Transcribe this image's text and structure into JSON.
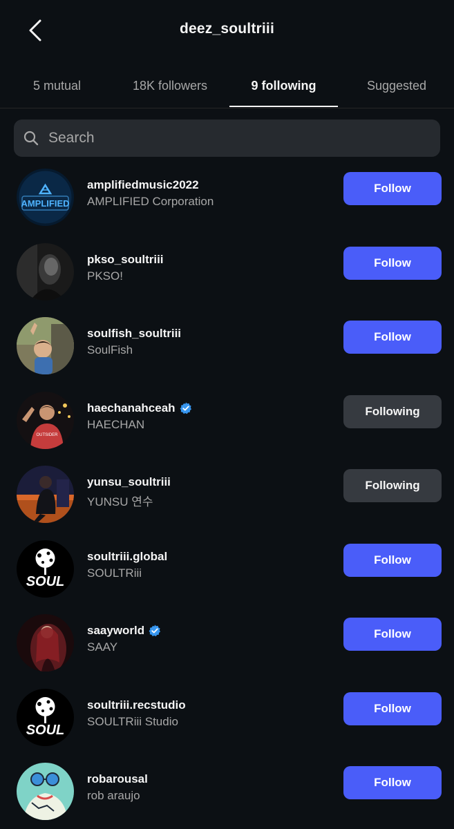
{
  "header": {
    "title": "deez_soultriii"
  },
  "tabs": [
    {
      "label": "5 mutual"
    },
    {
      "label": "18K followers"
    },
    {
      "label": "9 following"
    },
    {
      "label": "Suggested"
    }
  ],
  "search": {
    "placeholder": "Search"
  },
  "users": [
    {
      "username": "amplifiedmusic2022",
      "fullname": "AMPLIFIED Corporation",
      "verified": false,
      "button": "Follow",
      "avatar_text": "AMPLIFIED"
    },
    {
      "username": "pkso_soultriii",
      "fullname": "PKSO!",
      "verified": false,
      "button": "Follow"
    },
    {
      "username": "soulfish_soultriii",
      "fullname": "SoulFish",
      "verified": false,
      "button": "Follow"
    },
    {
      "username": "haechanahceah",
      "fullname": "HAECHAN",
      "verified": true,
      "button": "Following"
    },
    {
      "username": "yunsu_soultriii",
      "fullname": "YUNSU 연수",
      "verified": false,
      "button": "Following"
    },
    {
      "username": "soultriii.global",
      "fullname": "SOULTRiii",
      "verified": false,
      "button": "Follow",
      "avatar_text": "SOUL"
    },
    {
      "username": "saayworld",
      "fullname": "SAAY",
      "verified": true,
      "button": "Follow"
    },
    {
      "username": "soultriii.recstudio",
      "fullname": "SOULTRiii Studio",
      "verified": false,
      "button": "Follow",
      "avatar_text": "SOUL"
    },
    {
      "username": "robarousal",
      "fullname": "rob araujo",
      "verified": false,
      "button": "Follow"
    }
  ],
  "colors": {
    "background": "#0c1014",
    "follow_button": "#4a5df9",
    "following_button": "#363a40",
    "verified": "#3897f0"
  }
}
